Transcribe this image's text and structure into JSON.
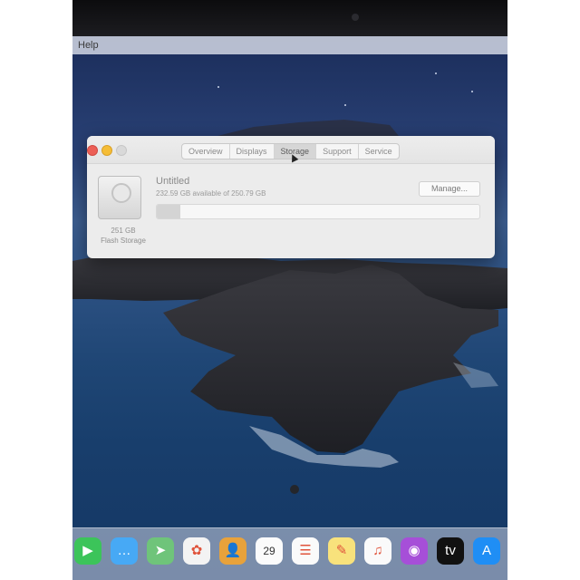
{
  "menubar": {
    "help": "Help"
  },
  "window": {
    "tabs": [
      {
        "label": "Overview",
        "active": false
      },
      {
        "label": "Displays",
        "active": false
      },
      {
        "label": "Storage",
        "active": true
      },
      {
        "label": "Support",
        "active": false
      },
      {
        "label": "Service",
        "active": false
      }
    ],
    "drive": {
      "size": "251 GB",
      "type": "Flash Storage"
    },
    "volume": {
      "name": "Untitled",
      "availability": "232.59 GB available of 250.79 GB",
      "used_fraction": 0.0725
    },
    "manage_label": "Manage..."
  },
  "dock": {
    "icons": [
      {
        "name": "facetime-icon",
        "color": "#3cc45a",
        "glyph": "▶"
      },
      {
        "name": "messages-icon",
        "color": "#47a9f5",
        "glyph": "…"
      },
      {
        "name": "maps-icon",
        "color": "#6fc47a",
        "glyph": "➤"
      },
      {
        "name": "photos-icon",
        "color": "#f3f3f3",
        "glyph": "✿"
      },
      {
        "name": "contacts-icon",
        "color": "#e8a23b",
        "glyph": "👤"
      },
      {
        "name": "calendar-icon",
        "color": "#fbfbfb",
        "glyph": "29"
      },
      {
        "name": "reminders-icon",
        "color": "#fafafa",
        "glyph": "☰"
      },
      {
        "name": "notes-icon",
        "color": "#f8e27c",
        "glyph": "✎"
      },
      {
        "name": "music-icon",
        "color": "#fafafa",
        "glyph": "♫"
      },
      {
        "name": "podcasts-icon",
        "color": "#a64fd8",
        "glyph": "◉"
      },
      {
        "name": "apple-tv-icon",
        "color": "#111111",
        "glyph": "tv"
      },
      {
        "name": "app-store-icon",
        "color": "#1f8ef5",
        "glyph": "A"
      }
    ]
  }
}
